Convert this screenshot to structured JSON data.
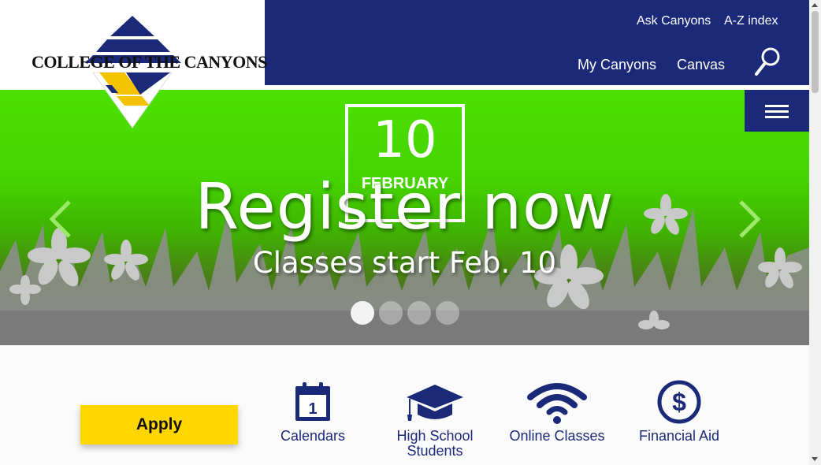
{
  "header": {
    "logo_text": "COLLEGE OF THE CANYONS",
    "utility_links": [
      "Ask Canyons",
      "A-Z index"
    ],
    "main_links": [
      "My Canyons",
      "Canvas"
    ],
    "search_icon": "search-icon",
    "menu_icon": "hamburger-menu-icon"
  },
  "hero": {
    "date_day": "10",
    "date_month": "FEBRUARY",
    "title": "Register now",
    "subtitle": "Classes start Feb. 10",
    "slide_count": 4,
    "active_slide": 1
  },
  "quick_links": {
    "apply_label": "Apply",
    "items": [
      {
        "label": "Calendars",
        "icon": "calendar-icon"
      },
      {
        "label": "High School Students",
        "icon": "graduation-cap-icon"
      },
      {
        "label": "Online Classes",
        "icon": "wifi-icon"
      },
      {
        "label": "Financial Aid",
        "icon": "dollar-icon"
      }
    ]
  },
  "colors": {
    "navy": "#1a2a78",
    "gold": "#ffd700",
    "hero_green": "#4ce000"
  }
}
